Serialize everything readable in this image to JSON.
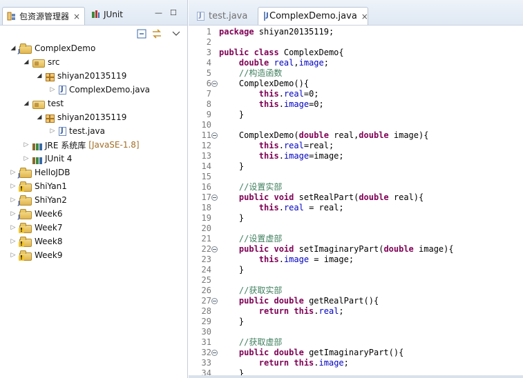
{
  "left_panel": {
    "tabs": [
      {
        "label": "包资源管理器",
        "close": "×"
      },
      {
        "label": "JUnit"
      }
    ],
    "view_controls": {
      "minimize": "—",
      "maximize": "☐"
    },
    "toolbar_icons": [
      "collapse-all-icon",
      "link-with-editor-icon",
      "view-menu-icon"
    ],
    "tree": [
      {
        "label": "ComplexDemo",
        "icon": "java-project-icon",
        "expanded": true,
        "depth": 0
      },
      {
        "label": "src",
        "icon": "source-folder-icon",
        "expanded": true,
        "depth": 1
      },
      {
        "label": "shiyan20135119",
        "icon": "package-icon",
        "expanded": true,
        "depth": 2
      },
      {
        "label": "ComplexDemo.java",
        "icon": "java-file-icon",
        "expanded": false,
        "depth": 3
      },
      {
        "label": "test",
        "icon": "source-folder-icon",
        "expanded": true,
        "depth": 1
      },
      {
        "label": "shiyan20135119",
        "icon": "package-icon",
        "expanded": true,
        "depth": 2
      },
      {
        "label": "test.java",
        "icon": "java-file-icon",
        "expanded": false,
        "depth": 3
      },
      {
        "label": "JRE 系统库",
        "decoration": "[JavaSE-1.8]",
        "icon": "library-icon",
        "expanded": false,
        "depth": 1
      },
      {
        "label": "JUnit 4",
        "icon": "library-icon",
        "expanded": false,
        "depth": 1
      },
      {
        "label": "HelloJDB",
        "icon": "java-project-icon",
        "expanded": false,
        "depth": 0
      },
      {
        "label": "ShiYan1",
        "icon": "java-project-warning-icon",
        "expanded": false,
        "depth": 0
      },
      {
        "label": "ShiYan2",
        "icon": "java-project-icon",
        "expanded": false,
        "depth": 0
      },
      {
        "label": "Week6",
        "icon": "java-project-icon",
        "expanded": false,
        "depth": 0
      },
      {
        "label": "Week7",
        "icon": "java-project-warning-icon",
        "expanded": false,
        "depth": 0
      },
      {
        "label": "Week8",
        "icon": "java-project-warning-icon",
        "expanded": false,
        "depth": 0
      },
      {
        "label": "Week9",
        "icon": "java-project-warning-icon",
        "expanded": false,
        "depth": 0
      }
    ]
  },
  "editor": {
    "tabs": [
      {
        "label": "test.java",
        "active": false
      },
      {
        "label": "ComplexDemo.java",
        "active": true,
        "close": "×"
      }
    ],
    "lines": [
      {
        "n": "1",
        "fold": false,
        "tokens": [
          {
            "t": "package ",
            "c": "kw"
          },
          {
            "t": "shiyan20135119;",
            "c": "plain"
          }
        ]
      },
      {
        "n": "2",
        "fold": false,
        "tokens": []
      },
      {
        "n": "3",
        "fold": false,
        "tokens": [
          {
            "t": "public class ",
            "c": "kw"
          },
          {
            "t": "ComplexDemo{",
            "c": "plain"
          }
        ]
      },
      {
        "n": "4",
        "fold": false,
        "tokens": [
          {
            "t": "    ",
            "c": "plain"
          },
          {
            "t": "double ",
            "c": "kw"
          },
          {
            "t": "real",
            "c": "fld"
          },
          {
            "t": ",",
            "c": "plain"
          },
          {
            "t": "image",
            "c": "fld"
          },
          {
            "t": ";",
            "c": "plain"
          }
        ]
      },
      {
        "n": "5",
        "fold": false,
        "tokens": [
          {
            "t": "    //构造函数",
            "c": "cmt"
          }
        ]
      },
      {
        "n": "6",
        "fold": true,
        "tokens": [
          {
            "t": "    ComplexDemo(){",
            "c": "plain"
          }
        ]
      },
      {
        "n": "7",
        "fold": false,
        "tokens": [
          {
            "t": "        ",
            "c": "plain"
          },
          {
            "t": "this",
            "c": "kw"
          },
          {
            "t": ".",
            "c": "plain"
          },
          {
            "t": "real",
            "c": "fld"
          },
          {
            "t": "=0;",
            "c": "plain"
          }
        ]
      },
      {
        "n": "8",
        "fold": false,
        "tokens": [
          {
            "t": "        ",
            "c": "plain"
          },
          {
            "t": "this",
            "c": "kw"
          },
          {
            "t": ".",
            "c": "plain"
          },
          {
            "t": "image",
            "c": "fld"
          },
          {
            "t": "=0;",
            "c": "plain"
          }
        ]
      },
      {
        "n": "9",
        "fold": false,
        "tokens": [
          {
            "t": "    }",
            "c": "plain"
          }
        ]
      },
      {
        "n": "10",
        "fold": false,
        "tokens": []
      },
      {
        "n": "11",
        "fold": true,
        "tokens": [
          {
            "t": "    ComplexDemo(",
            "c": "plain"
          },
          {
            "t": "double ",
            "c": "kw"
          },
          {
            "t": "real,",
            "c": "plain"
          },
          {
            "t": "double ",
            "c": "kw"
          },
          {
            "t": "image){",
            "c": "plain"
          }
        ]
      },
      {
        "n": "12",
        "fold": false,
        "tokens": [
          {
            "t": "        ",
            "c": "plain"
          },
          {
            "t": "this",
            "c": "kw"
          },
          {
            "t": ".",
            "c": "plain"
          },
          {
            "t": "real",
            "c": "fld"
          },
          {
            "t": "=real;",
            "c": "plain"
          }
        ]
      },
      {
        "n": "13",
        "fold": false,
        "tokens": [
          {
            "t": "        ",
            "c": "plain"
          },
          {
            "t": "this",
            "c": "kw"
          },
          {
            "t": ".",
            "c": "plain"
          },
          {
            "t": "image",
            "c": "fld"
          },
          {
            "t": "=image;",
            "c": "plain"
          }
        ]
      },
      {
        "n": "14",
        "fold": false,
        "tokens": [
          {
            "t": "    }",
            "c": "plain"
          }
        ]
      },
      {
        "n": "15",
        "fold": false,
        "tokens": []
      },
      {
        "n": "16",
        "fold": false,
        "tokens": [
          {
            "t": "    //设置实部",
            "c": "cmt"
          }
        ]
      },
      {
        "n": "17",
        "fold": true,
        "tokens": [
          {
            "t": "    ",
            "c": "plain"
          },
          {
            "t": "public void ",
            "c": "kw"
          },
          {
            "t": "setRealPart(",
            "c": "plain"
          },
          {
            "t": "double ",
            "c": "kw"
          },
          {
            "t": "real){",
            "c": "plain"
          }
        ]
      },
      {
        "n": "18",
        "fold": false,
        "tokens": [
          {
            "t": "        ",
            "c": "plain"
          },
          {
            "t": "this",
            "c": "kw"
          },
          {
            "t": ".",
            "c": "plain"
          },
          {
            "t": "real",
            "c": "fld"
          },
          {
            "t": " = real;",
            "c": "plain"
          }
        ]
      },
      {
        "n": "19",
        "fold": false,
        "tokens": [
          {
            "t": "    }",
            "c": "plain"
          }
        ]
      },
      {
        "n": "20",
        "fold": false,
        "tokens": []
      },
      {
        "n": "21",
        "fold": false,
        "tokens": [
          {
            "t": "    //设置虚部",
            "c": "cmt"
          }
        ]
      },
      {
        "n": "22",
        "fold": true,
        "tokens": [
          {
            "t": "    ",
            "c": "plain"
          },
          {
            "t": "public void ",
            "c": "kw"
          },
          {
            "t": "setImaginaryPart(",
            "c": "plain"
          },
          {
            "t": "double ",
            "c": "kw"
          },
          {
            "t": "image){",
            "c": "plain"
          }
        ]
      },
      {
        "n": "23",
        "fold": false,
        "tokens": [
          {
            "t": "        ",
            "c": "plain"
          },
          {
            "t": "this",
            "c": "kw"
          },
          {
            "t": ".",
            "c": "plain"
          },
          {
            "t": "image",
            "c": "fld"
          },
          {
            "t": " = image;",
            "c": "plain"
          }
        ]
      },
      {
        "n": "24",
        "fold": false,
        "tokens": [
          {
            "t": "    }",
            "c": "plain"
          }
        ]
      },
      {
        "n": "25",
        "fold": false,
        "tokens": []
      },
      {
        "n": "26",
        "fold": false,
        "tokens": [
          {
            "t": "    //获取实部",
            "c": "cmt"
          }
        ]
      },
      {
        "n": "27",
        "fold": true,
        "tokens": [
          {
            "t": "    ",
            "c": "plain"
          },
          {
            "t": "public double ",
            "c": "kw"
          },
          {
            "t": "getRealPart(){",
            "c": "plain"
          }
        ]
      },
      {
        "n": "28",
        "fold": false,
        "tokens": [
          {
            "t": "        ",
            "c": "plain"
          },
          {
            "t": "return this",
            "c": "kw"
          },
          {
            "t": ".",
            "c": "plain"
          },
          {
            "t": "real",
            "c": "fld"
          },
          {
            "t": ";",
            "c": "plain"
          }
        ]
      },
      {
        "n": "29",
        "fold": false,
        "tokens": [
          {
            "t": "    }",
            "c": "plain"
          }
        ]
      },
      {
        "n": "30",
        "fold": false,
        "tokens": []
      },
      {
        "n": "31",
        "fold": false,
        "tokens": [
          {
            "t": "    //获取虚部",
            "c": "cmt"
          }
        ]
      },
      {
        "n": "32",
        "fold": true,
        "tokens": [
          {
            "t": "    ",
            "c": "plain"
          },
          {
            "t": "public double ",
            "c": "kw"
          },
          {
            "t": "getImaginaryPart(){",
            "c": "plain"
          }
        ]
      },
      {
        "n": "33",
        "fold": false,
        "tokens": [
          {
            "t": "        ",
            "c": "plain"
          },
          {
            "t": "return this",
            "c": "kw"
          },
          {
            "t": ".",
            "c": "plain"
          },
          {
            "t": "image",
            "c": "fld"
          },
          {
            "t": ";",
            "c": "plain"
          }
        ]
      },
      {
        "n": "34",
        "fold": false,
        "tokens": [
          {
            "t": "    }",
            "c": "plain"
          }
        ]
      }
    ]
  },
  "colors": {
    "keyword": "#7f0055",
    "field": "#0000c0",
    "comment": "#3f7f5f",
    "line_number": "#787878",
    "decoration": "#a26d25",
    "tab_bar": "#dfe8f3"
  }
}
